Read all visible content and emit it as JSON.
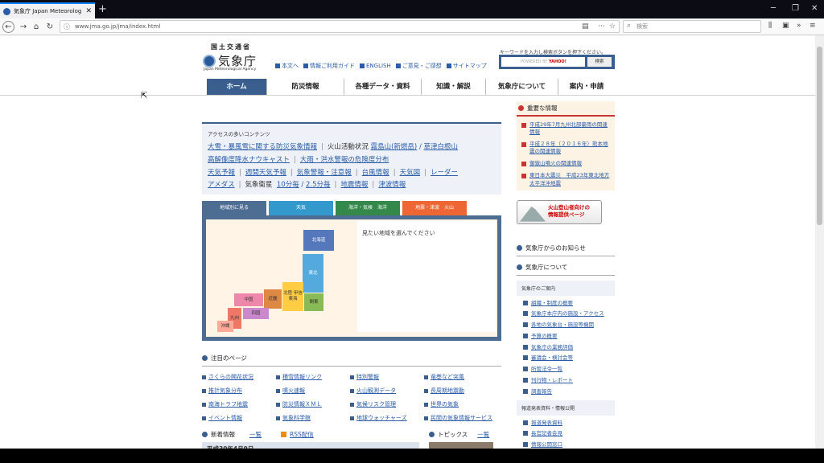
{
  "browser": {
    "tab_title": "気象庁 Japan Meteorological Agency",
    "url": "www.jma.go.jp/jma/index.html",
    "search_placeholder": "検索"
  },
  "header": {
    "ministry": "国土交通省",
    "logo": "気象庁",
    "logo_en": "Japan Meteorological Agency",
    "links": [
      "本文へ",
      "情報ご利用ガイド",
      "ENGLISH",
      "ご意見・ご感想",
      "サイトマップ"
    ],
    "search_hint": "キーワードを入力し検索ボタンを押下ください。",
    "search_powered": "POWERED BY",
    "search_brand": "YAHOO!",
    "search_button": "検索"
  },
  "nav": [
    "ホーム",
    "防災情報",
    "各種データ・資料",
    "知識・解説",
    "気象庁について",
    "案内・申請"
  ],
  "access": {
    "title": "アクセスの多いコンテンツ",
    "row1": {
      "a": "大雪・暴風雪に関する防災気象情報",
      "b": "火山活動状況",
      "c": "霧島山(新燃岳)",
      "d": "草津白根山"
    },
    "row2": {
      "a": "高解像度降水ナウキャスト",
      "b": "大雨・洪水警報の危険度分布"
    },
    "row3": [
      "天気予報",
      "週間天気予報",
      "気象警報・注意報",
      "台風情報",
      "天気図",
      "レーダー"
    ],
    "row4": {
      "a": "アメダス",
      "b": "気象衛星",
      "c": "10分毎",
      "d": "2.5分毎",
      "e": "地震情報",
      "f": "津波情報"
    }
  },
  "map_tabs": [
    "地域別に見る",
    "天気",
    "海洋・気候　海洋",
    "地震・津波　火山"
  ],
  "map": {
    "prompt": "見たい地域を選んでください",
    "regions": [
      "北海道",
      "東北",
      "関東",
      "北陸 甲信 東海",
      "近畿",
      "中国",
      "四国",
      "九州",
      "沖縄"
    ]
  },
  "attention": {
    "title": "注目のページ",
    "items": [
      "さくらの開花状況",
      "積雪情報リンク",
      "特別警報",
      "竜巻など突風",
      "推計気象分布",
      "噴火速報",
      "火山観測データ",
      "長周期地震動",
      "南海トラフ地震",
      "防災情報ＸＭＬ",
      "気候リスク管理",
      "世界の気象",
      "イベント情報",
      "気象科学館",
      "地球ウォッチャーズ",
      "民間の気象情報サービス"
    ]
  },
  "news": {
    "title": "新着情報",
    "list": "一覧",
    "rss": "RSS配信",
    "date": "平成30年4月9日"
  },
  "topics": {
    "title": "トピックス",
    "list": "一覧"
  },
  "important": {
    "title": "重要な情報",
    "items": [
      "平成29年7月九州北部豪雨の関連情報",
      "平成２８年（２０１６年）熊本地震の関連情報",
      "御嶽山噴火の関連情報",
      "東日本大震災　平成23年東北地方太平洋沖地震"
    ]
  },
  "volcano_banner": {
    "line1": "火山登山者向けの",
    "line2": "情報提供ページ"
  },
  "side": {
    "notice": "気象庁からのお知らせ",
    "about": "気象庁について",
    "guide": "気象庁のご案内",
    "links": [
      "組織・制度の概要",
      "気象庁本庁内の施設・アクセス",
      "各地の気象台・施設等機関",
      "予算の概要",
      "気象庁の業務評価",
      "審議会・検討会等",
      "所管法令一覧",
      "刊行物・レポート",
      "調査報告"
    ],
    "press": "報道発表資料・情報公開",
    "press_links": [
      "報道発表資料",
      "長官記者会見",
      "情報公開窓口"
    ]
  }
}
